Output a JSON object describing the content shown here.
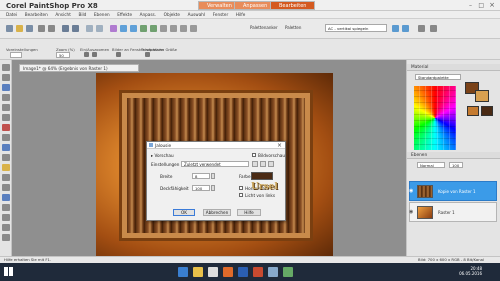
{
  "app": {
    "title": "Corel PaintShop Pro X8",
    "mode_tabs": [
      {
        "label": "Verwalten",
        "color": "#e88c5a"
      },
      {
        "label": "Anpassen",
        "color": "#e88c5a"
      },
      {
        "label": "Bearbeiten",
        "color": "#d45a20"
      }
    ]
  },
  "menu": [
    "Datei",
    "Bearbeiten",
    "Ansicht",
    "Bild",
    "Ebenen",
    "Effekte",
    "Anpass.",
    "Objekte",
    "Auswahl",
    "Fenster",
    "Hilfe"
  ],
  "toolbar": {
    "right_items": [
      "Palettenanker",
      "Paletten"
    ],
    "right_select": "AC - vertikal spiegeln"
  },
  "options": {
    "preset_label": "Voreinstellungen",
    "zoom_label": "Zoom (%)",
    "zoom_value": "50",
    "fit_label": "Ein/Auszoomen",
    "fit_window_label": "Bilder an Fenster anpassen",
    "actual_size_label": "Tatsächliche Größe"
  },
  "document": {
    "tab_label": "Image1* @ 64% (Ergebnis von Raster 1)"
  },
  "dialog": {
    "title": "Jalousie",
    "preview_label": "Vorschau",
    "preview_check": "Bildvorschau",
    "settings_label": "Einstellungen",
    "settings_value": "Zuletzt verwendet",
    "width_label": "Breite",
    "width_value": "8",
    "opacity_label": "Deckfähigkeit",
    "opacity_value": "100",
    "color_label": "Farbe:",
    "color_value": "#4a2a14",
    "horizontal_label": "Horizontal",
    "light_label": "Licht von links",
    "ok_label": "OK",
    "cancel_label": "Abbrechen",
    "help_label": "Hilfe",
    "watermark": "Ursel"
  },
  "material": {
    "header": "Material",
    "palette_select": "Standardpalette"
  },
  "layers": {
    "header": "Ebenen",
    "mode": "Normal",
    "opacity": "100",
    "items": [
      {
        "label": "Kopie von Raster 1"
      },
      {
        "label": "Raster 1"
      }
    ]
  },
  "status": {
    "left": "Hilfe erhalten Sie mit F1.",
    "right": "Bild: 700 x 600 x RGB - 8 Bit/Kanal"
  },
  "taskbar": {
    "time": "20:48",
    "date": "06.05.2016"
  }
}
